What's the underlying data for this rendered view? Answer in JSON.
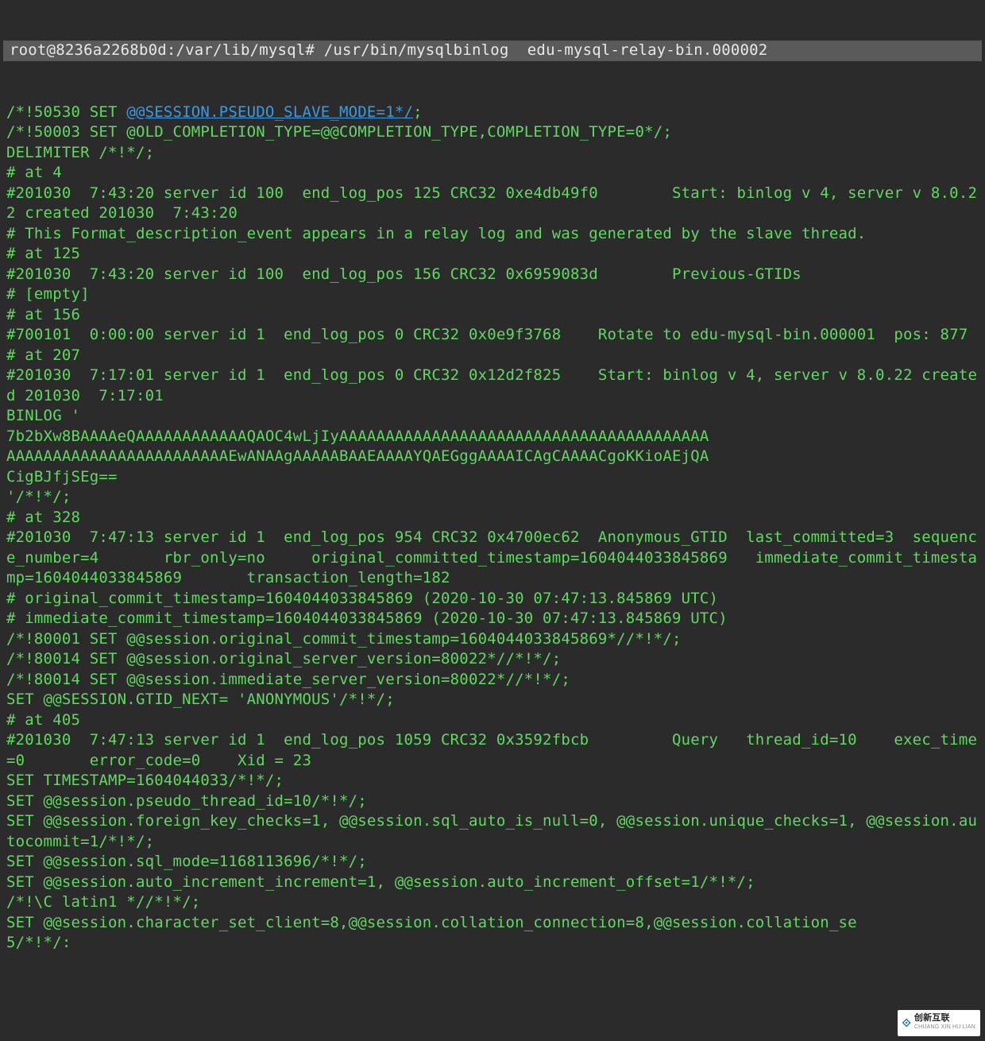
{
  "prompt_prefix": "root@8236a2268b0d:/var/lib/mysql#",
  "command": "/usr/bin/mysqlbinlog  edu-mysql-relay-bin.000002",
  "lines": {
    "l0a": "/*!50530 SET ",
    "l0_link": "@@SESSION.PSEUDO_SLAVE_MODE=1*/",
    "l0b": ";",
    "l1": "/*!50003 SET @OLD_COMPLETION_TYPE=@@COMPLETION_TYPE,COMPLETION_TYPE=0*/;",
    "l2": "DELIMITER /*!*/;",
    "l3": "# at 4",
    "l4": "#201030  7:43:20 server id 100  end_log_pos 125 CRC32 0xe4db49f0        Start: binlog v 4, server v 8.0.22 created 201030  7:43:20",
    "l5": "# This Format_description_event appears in a relay log and was generated by the slave thread.",
    "l6": "# at 125",
    "l7": "#201030  7:43:20 server id 100  end_log_pos 156 CRC32 0x6959083d        Previous-GTIDs",
    "l8": "# [empty]",
    "l9": "# at 156",
    "l10": "#700101  0:00:00 server id 1  end_log_pos 0 CRC32 0x0e9f3768    Rotate to edu-mysql-bin.000001  pos: 877",
    "l11": "# at 207",
    "l12": "#201030  7:17:01 server id 1  end_log_pos 0 CRC32 0x12d2f825    Start: binlog v 4, server v 8.0.22 created 201030  7:17:01",
    "l13": "BINLOG '",
    "l14": "7b2bXw8BAAAAeQAAAAAAAAAAAAQAOC4wLjIyAAAAAAAAAAAAAAAAAAAAAAAAAAAAAAAAAAAAAAAA",
    "l15": "AAAAAAAAAAAAAAAAAAAAAAAAEwANAAgAAAAABAAEAAAAYQAEGggAAAAICAgCAAAACgoKKioAEjQA",
    "l16": "CigBJfjSEg==",
    "l17": "'/*!*/;",
    "l18": "# at 328",
    "l19": "#201030  7:47:13 server id 1  end_log_pos 954 CRC32 0x4700ec62  Anonymous_GTID  last_committed=3  sequence_number=4       rbr_only=no     original_committed_timestamp=1604044033845869   immediate_commit_timestamp=1604044033845869       transaction_length=182",
    "l20": "# original_commit_timestamp=1604044033845869 (2020-10-30 07:47:13.845869 UTC)",
    "l21": "# immediate_commit_timestamp=1604044033845869 (2020-10-30 07:47:13.845869 UTC)",
    "l22": "/*!80001 SET @@session.original_commit_timestamp=1604044033845869*//*!*/;",
    "l23": "/*!80014 SET @@session.original_server_version=80022*//*!*/;",
    "l24": "/*!80014 SET @@session.immediate_server_version=80022*//*!*/;",
    "l25": "SET @@SESSION.GTID_NEXT= 'ANONYMOUS'/*!*/;",
    "l26": "# at 405",
    "l27": "#201030  7:47:13 server id 1  end_log_pos 1059 CRC32 0x3592fbcb         Query   thread_id=10    exec_time=0       error_code=0    Xid = 23",
    "l28": "SET TIMESTAMP=1604044033/*!*/;",
    "l29": "SET @@session.pseudo_thread_id=10/*!*/;",
    "l30": "SET @@session.foreign_key_checks=1, @@session.sql_auto_is_null=0, @@session.unique_checks=1, @@session.autocommit=1/*!*/;",
    "l31": "SET @@session.sql_mode=1168113696/*!*/;",
    "l32": "SET @@session.auto_increment_increment=1, @@session.auto_increment_offset=1/*!*/;",
    "l33": "/*!\\C latin1 *//*!*/;",
    "l34": "SET @@session.character_set_client=8,@@session.collation_connection=8,@@session.collation_se",
    "l35": "5/*!*/:"
  },
  "watermark": {
    "brand": "创新互联",
    "sub": "CHUANG XIN HU LIAN"
  }
}
